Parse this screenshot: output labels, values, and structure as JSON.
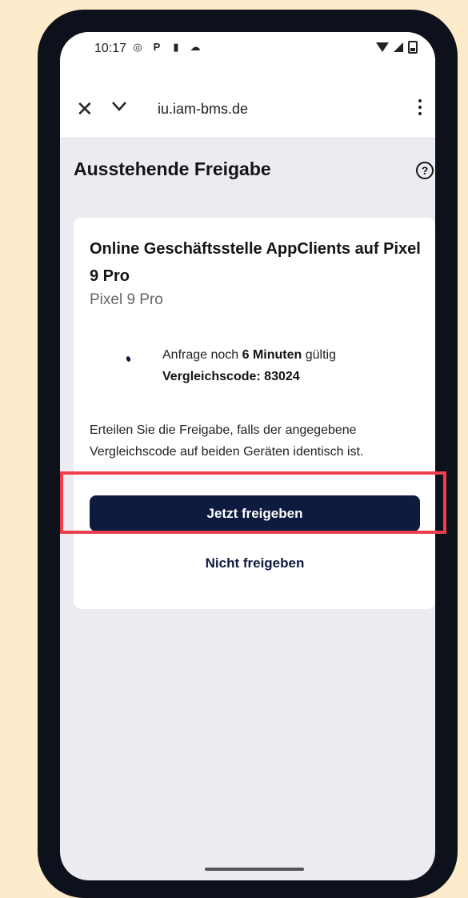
{
  "status_bar": {
    "time": "10:17",
    "left_icons": [
      "whatsapp-icon",
      "paypal-icon",
      "notification-icon",
      "cloud-icon"
    ],
    "right_icons": [
      "wifi-icon",
      "signal-icon",
      "battery-icon"
    ]
  },
  "browser": {
    "url": "iu.iam-bms.de",
    "close_label": "✕",
    "menu_icon": "more-vert-icon"
  },
  "page": {
    "title": "Ausstehende Freigabe",
    "help_label": "?"
  },
  "card": {
    "title": "Online Geschäftsstelle AppClients auf Pixel 9 Pro",
    "device": "Pixel 9 Pro",
    "request_prefix": "Anfrage noch ",
    "request_time": "6 Minuten",
    "request_suffix": " gültig",
    "code_line": "Vergleichscode: 83024",
    "info_text": "Erteilen Sie die Freigabe, falls der angegebene Vergleichscode auf beiden Geräten identisch ist.",
    "approve_label": "Jetzt freigeben",
    "reject_label": "Nicht freigeben"
  },
  "colors": {
    "accent": "#0e1b3f",
    "highlight": "#ef3f4c",
    "background": "#fdebcc"
  }
}
